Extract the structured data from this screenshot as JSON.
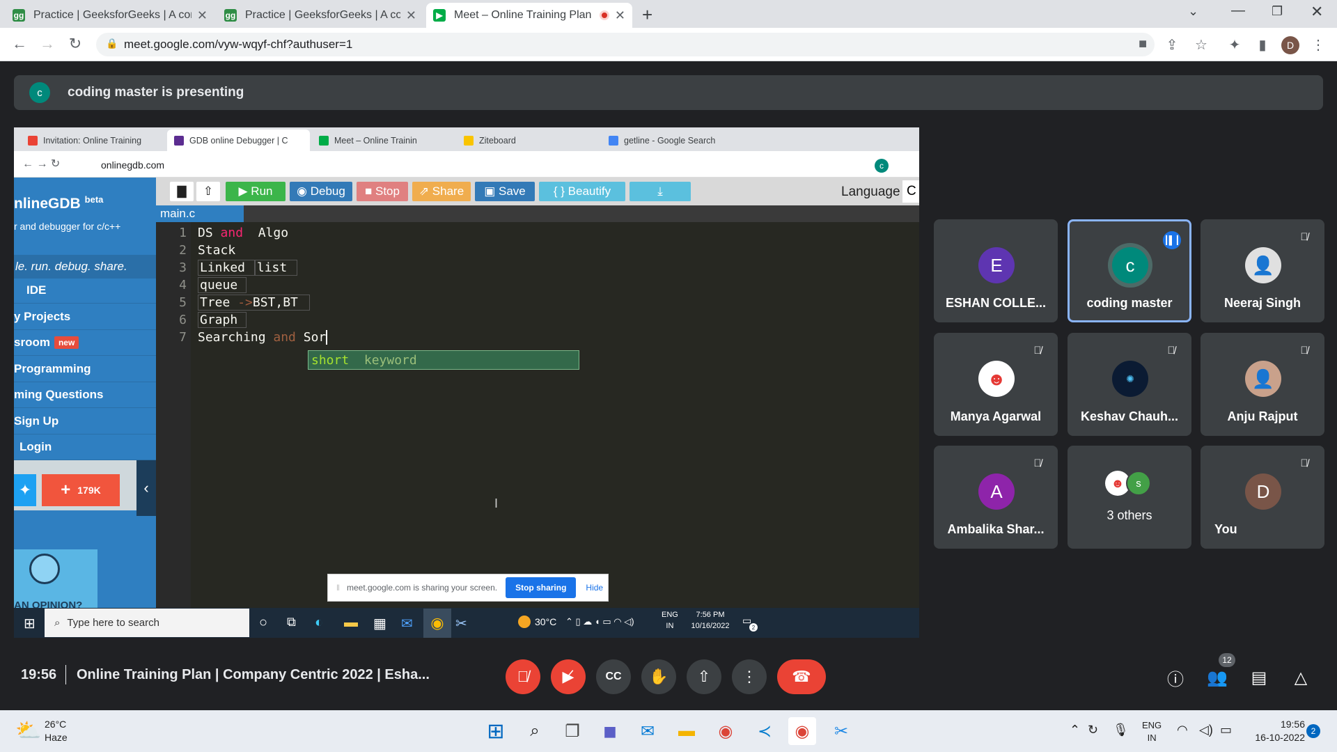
{
  "browser": {
    "tabs": [
      {
        "label": "Practice | GeeksforGeeks | A com",
        "icon": "gfg-icon"
      },
      {
        "label": "Practice | GeeksforGeeks | A com",
        "icon": "gfg-icon"
      },
      {
        "label": "Meet – Online Training Plan |",
        "icon": "meet-icon",
        "recording": true
      }
    ],
    "url": "meet.google.com/vyw-wqyf-chf?authuser=1",
    "profile_initial": "D"
  },
  "presenting_banner": {
    "initial": "c",
    "text": "coding master is presenting"
  },
  "shared_screen": {
    "tabs": [
      {
        "label": "Invitation: Online Training"
      },
      {
        "label": "GDB online Debugger | C"
      },
      {
        "label": "Meet – Online Trainin"
      },
      {
        "label": "Ziteboard"
      },
      {
        "label": "getline - Google Search"
      }
    ],
    "url": "onlinegdb.com",
    "profile_initial": "c",
    "gdb": {
      "logo": "nlineGDB",
      "logo_sup": "beta",
      "tagline": "r and debugger for c/c++",
      "slogan": "le. run. debug. share.",
      "menu": [
        "IDE",
        "y Projects",
        "sroom",
        "Programming",
        "ming Questions",
        "Sign Up",
        "Login"
      ],
      "new_badge": "new",
      "share_count": "179K",
      "opinion_text": "AN OPINION?",
      "toolbar": {
        "run": "Run",
        "debug": "Debug",
        "stop": "Stop",
        "share": "Share",
        "save": "Save",
        "beautify": "{ } Beautify"
      },
      "language_label": "Language",
      "language_value": "C",
      "file_tab": "main.c",
      "line_numbers": [
        "1",
        "2",
        "3",
        "4",
        "5",
        "6",
        "7"
      ],
      "code_line1_a": "DS ",
      "code_line1_kw": "and",
      "code_line1_b": "  Algo",
      "code_line2": "Stack",
      "code_line3_a": "Linked ",
      "code_line3_b": "list",
      "code_line4": "queue",
      "code_line5_a": "Tree ",
      "code_line5_kw": "->",
      "code_line5_b": "BST,BT",
      "code_line6": "Graph",
      "code_line7_a": "Searching ",
      "code_line7_kw": "and",
      "code_line7_b": " Sor",
      "autocomplete_word": "short",
      "autocomplete_kind": "keyword"
    },
    "share_bar": {
      "text": "meet.google.com is sharing your screen.",
      "stop": "Stop sharing",
      "hide": "Hide"
    },
    "taskbar": {
      "search": "Type here to search",
      "temp": "30°C",
      "lang1": "ENG",
      "lang2": "IN",
      "time": "7:56 PM",
      "date": "10/16/2022",
      "notif": "2"
    }
  },
  "participants": [
    {
      "name": "ESHAN COLLE...",
      "initial": "E",
      "color": "#5e35b1",
      "muted": false
    },
    {
      "name": "coding master",
      "initial": "c",
      "color": "#00897b",
      "muted": false,
      "speaking": true
    },
    {
      "name": "Neeraj Singh",
      "initial": "",
      "color": "#f5f5f5",
      "muted": true
    },
    {
      "name": "Manya Agarwal",
      "initial": "",
      "color": "#ffffff",
      "muted": true
    },
    {
      "name": "Keshav Chauh...",
      "initial": "",
      "color": "#0b1b33",
      "muted": true
    },
    {
      "name": "Anju Rajput",
      "initial": "",
      "color": "#c9a18b",
      "muted": true
    },
    {
      "name": "Ambalika Shar...",
      "initial": "A",
      "color": "#8e24aa",
      "muted": true
    },
    {
      "name": "3 others",
      "initial": "s",
      "color": "#43a047",
      "muted": false
    },
    {
      "name": "You",
      "initial": "D",
      "color": "#795548",
      "muted": true
    }
  ],
  "bottom_bar": {
    "time": "19:56",
    "meeting_title": "Online Training Plan | Company Centric 2022 | Esha...",
    "people_count": "12"
  },
  "taskbar": {
    "weather_temp": "26°C",
    "weather_desc": "Haze",
    "lang1": "ENG",
    "lang2": "IN",
    "time": "19:56",
    "date": "16-10-2022",
    "notif": "2"
  }
}
